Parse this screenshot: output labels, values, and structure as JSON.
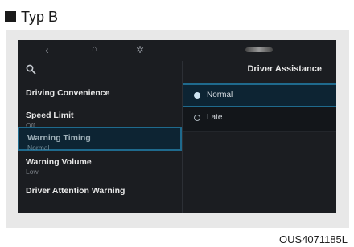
{
  "header": {
    "label": "Typ B"
  },
  "caption": "OUS4071185L",
  "screen": {
    "topbar": {
      "back": "‹",
      "home": "⌂",
      "settings": "✲"
    },
    "left_menu": [
      {
        "title": "Driving Convenience",
        "sub": ""
      },
      {
        "title": "Speed Limit",
        "sub": "Off"
      },
      {
        "title": "Warning Timing",
        "sub": "Normal"
      },
      {
        "title": "Warning Volume",
        "sub": "Low"
      },
      {
        "title": "Driver Attention Warning",
        "sub": ""
      }
    ],
    "right_title": "Driver Assistance",
    "options": [
      {
        "label": "Normal",
        "selected": true
      },
      {
        "label": "Late",
        "selected": false
      }
    ]
  }
}
